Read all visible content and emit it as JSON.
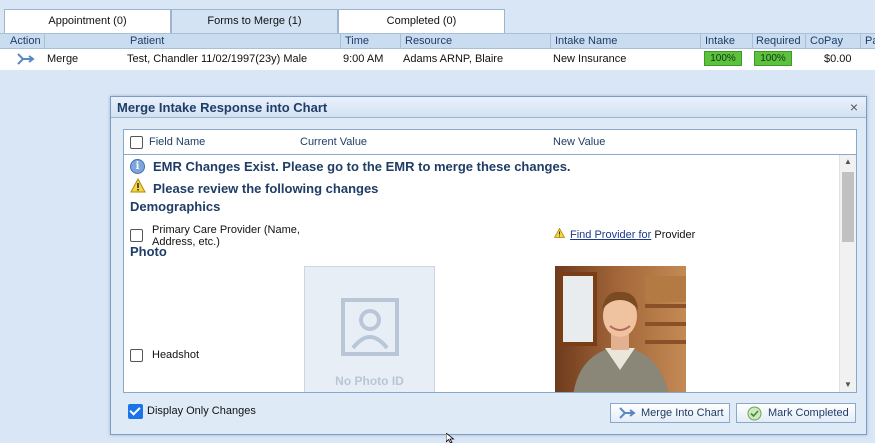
{
  "tabs": [
    {
      "label": "Appointment (0)",
      "active": false
    },
    {
      "label": "Forms to Merge (1)",
      "active": true
    },
    {
      "label": "Completed (0)",
      "active": false
    }
  ],
  "grid": {
    "columns": [
      "Action",
      "Patient",
      "Time",
      "Resource",
      "Intake Name",
      "Intake",
      "Required",
      "CoPay",
      "Pa"
    ],
    "row": {
      "action": "Merge",
      "patient": "Test, Chandler 11/02/1997(23y) Male",
      "time": "9:00 AM",
      "resource": "Adams ARNP, Blaire",
      "intake_name": "New Insurance",
      "intake": "100%",
      "required": "100%",
      "copay": "$0.00"
    }
  },
  "dialog": {
    "title": "Merge Intake Response into Chart",
    "close": "×",
    "columns": {
      "field_name": "Field Name",
      "current_value": "Current Value",
      "new_value": "New Value"
    },
    "info_message": "EMR Changes Exist. Please go to the EMR to merge these changes.",
    "warning_message": "Please review the following changes",
    "sections": {
      "demographics": "Demographics",
      "photo": "Photo"
    },
    "fields": {
      "primary_care": "Primary Care Provider (Name, Address, etc.)",
      "find_provider_link": "Find Provider for",
      "find_provider_suffix": " Provider",
      "headshot": "Headshot"
    },
    "no_photo_text": "No Photo ID",
    "display_only_changes": "Display Only Changes",
    "display_only_changes_checked": true,
    "buttons": {
      "merge": "Merge Into Chart",
      "complete": "Mark Completed"
    }
  },
  "icons": [
    "merge-icon",
    "info-icon",
    "warning-icon",
    "close-icon",
    "check-circle-icon"
  ],
  "colors": {
    "accent": "#1f3d66",
    "progress": "#5cc23e",
    "background": "#d9e6f5"
  }
}
